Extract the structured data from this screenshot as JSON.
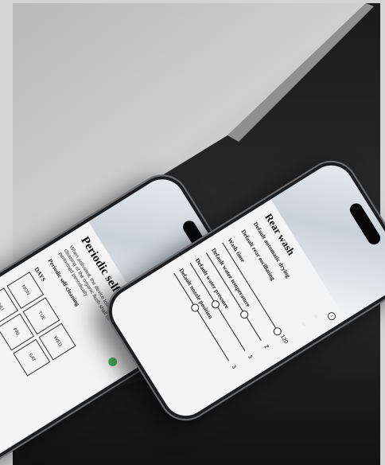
{
  "left_phone": {
    "title": "Periodic self-cleaning",
    "description": "When activated, the device toilet cleaning of the organic flush shall be performed periodically",
    "section_label": "Periodic self-cleaning",
    "days_label": "DAYS",
    "days": [
      "MON",
      "TUE",
      "WED",
      "THU",
      "FRI",
      "SAT"
    ],
    "day_mon_partial": "MON",
    "toggle_on": true
  },
  "right_phone": {
    "title": "Rear wash",
    "settings": [
      {
        "label": "Default automatic drying"
      },
      {
        "label": "Default rear oscillating"
      },
      {
        "label": "Wash time",
        "value": "120"
      },
      {
        "label": "Default water temperature",
        "value": "2"
      },
      {
        "label": "Default water pressure",
        "value": "3"
      },
      {
        "label": "Default nozzle position",
        "value": "3"
      }
    ],
    "toggles": [
      false,
      false
    ]
  },
  "colors": {
    "background": "#d4d4d4",
    "toggle_on": "#42b35a",
    "phone_body": "#1d1e20"
  }
}
